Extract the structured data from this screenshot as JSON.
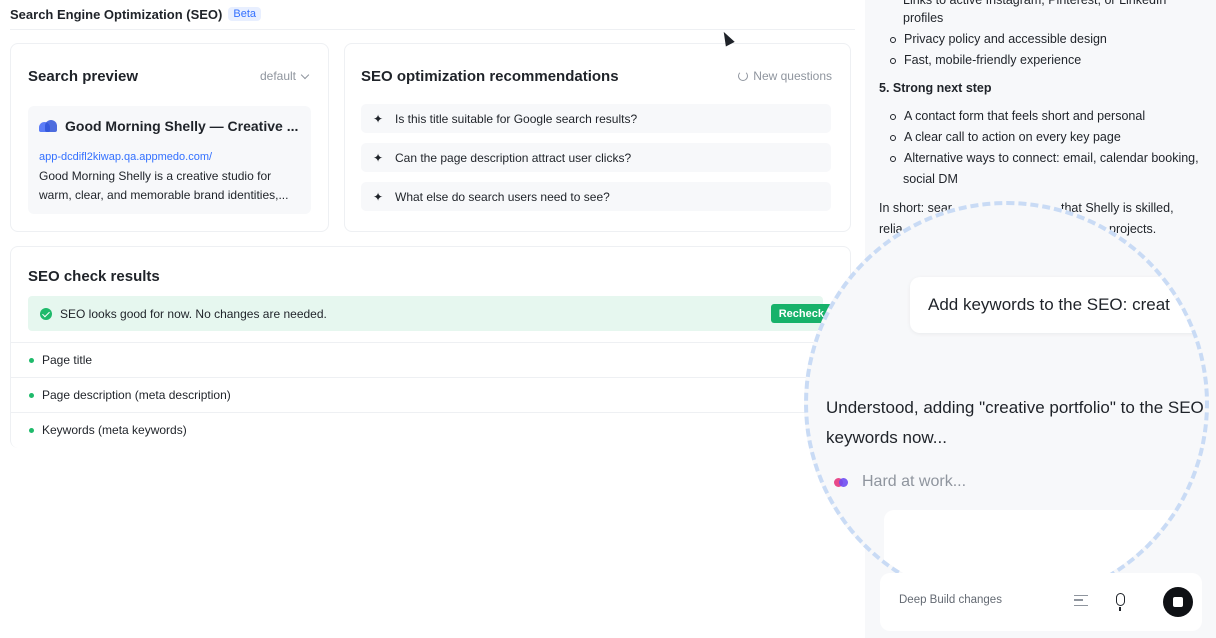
{
  "header": {
    "title": "Search Engine Optimization (SEO)",
    "badge": "Beta"
  },
  "preview": {
    "title": "Search preview",
    "select_value": "default",
    "serp_title": "Good Morning Shelly — Creative ...",
    "serp_url": "app-dcdifl2kiwap.qa.appmedo.com/",
    "serp_desc": "Good Morning Shelly is a creative studio for warm, clear, and memorable brand identities,..."
  },
  "recommendations": {
    "title": "SEO optimization recommendations",
    "new_questions_label": "New questions",
    "items": [
      "Is this title suitable for Google search results?",
      "Can the page description attract user clicks?",
      "What else do search users need to see?"
    ]
  },
  "check": {
    "title": "SEO check results",
    "status": "SEO looks good for now. No changes are needed.",
    "recheck_label": "Recheck",
    "rows": [
      "Page title",
      "Page description (meta description)",
      "Keywords (meta keywords)"
    ]
  },
  "chat": {
    "top_line_1": "Links to active Instagram, Pinterest, or LinkedIn",
    "top_line_2": "profiles",
    "bullets_a": [
      "Privacy policy and accessible design",
      "Fast, mobile-friendly experience"
    ],
    "heading_5": "5. Strong next step",
    "bullets_b": [
      "A contact form that feels short and personal",
      "A clear call to action on every key page",
      "Alternative ways to connect: email, calendar booking,"
    ],
    "bullet_b_cont": "social DM",
    "summary_line_1": "In short: sear",
    "summary_line_1b": "that Shelly is skilled,",
    "summary_line_2": "relia",
    "summary_line_2b": "projects.",
    "user_message": "Add keywords to the SEO: creat",
    "reply": "Understood, adding \"creative portfolio\" to the SEO keywords now...",
    "working": "Hard at work...",
    "composer_mode": "Deep Build",
    "composer_placeholder": "changes"
  },
  "colors": {
    "accent": "#3370ff",
    "success": "#17b26a",
    "panel": "#f7f8fa"
  }
}
